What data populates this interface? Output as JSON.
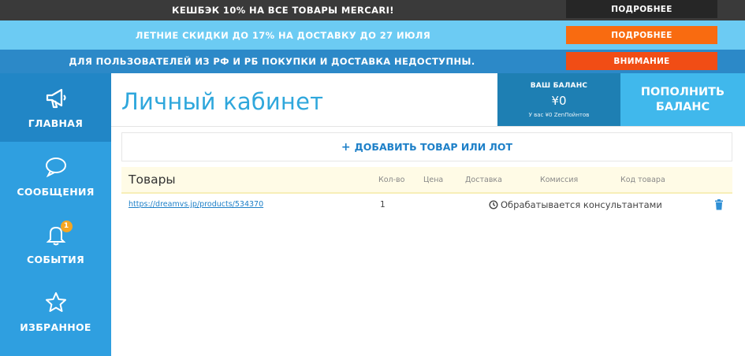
{
  "banners": [
    {
      "text": "КЕШБЭК 10% НА ВСЕ ТОВАРЫ MERCARI!",
      "button": "ПОДРОБНЕЕ"
    },
    {
      "text": "ЛЕТНИЕ СКИДКИ ДО 17% НА ДОСТАВКУ ДО 27 ИЮЛЯ",
      "button": "ПОДРОБНЕЕ"
    },
    {
      "text": "ДЛЯ ПОЛЬЗОВАТЕЛЕЙ ИЗ РФ И РБ ПОКУПКИ И ДОСТАВКА НЕДОСТУПНЫ.",
      "button": "ВНИМАНИЕ"
    }
  ],
  "sidebar": {
    "items": [
      {
        "label": "ГЛАВНАЯ",
        "icon": "megaphone-icon",
        "active": true
      },
      {
        "label": "СООБЩЕНИЯ",
        "icon": "chat-bubble-icon"
      },
      {
        "label": "СОБЫТИЯ",
        "icon": "bell-icon",
        "badge": "1"
      },
      {
        "label": "ИЗБРАННОЕ",
        "icon": "star-icon"
      }
    ]
  },
  "page": {
    "title": "Личный кабинет"
  },
  "balance": {
    "label": "ВАШ БАЛАНС",
    "value": "¥0",
    "zen_points": "У вас ¥0 ZenПойнтов"
  },
  "topup": {
    "line1": "ПОПОЛНИТЬ",
    "line2": "БАЛАНС"
  },
  "add_item": {
    "plus": "+",
    "label": "ДОБАВИТЬ ТОВАР ИЛИ ЛОТ"
  },
  "goods": {
    "title": "Товары",
    "columns": [
      "Кол-во",
      "Цена",
      "Доставка",
      "Комиссия",
      "Код товара"
    ],
    "rows": [
      {
        "link": "https://dreamvs.jp/products/534370",
        "qty": "1",
        "status": "Обрабатывается консультантами"
      }
    ]
  },
  "colors": {
    "sidebar": "#2f9fe0",
    "sidebar_active": "#2186c6",
    "accent_orange": "#f96b10",
    "accent_red": "#f14d15",
    "title_blue": "#2fa7dc",
    "badge": "#f5a623"
  }
}
